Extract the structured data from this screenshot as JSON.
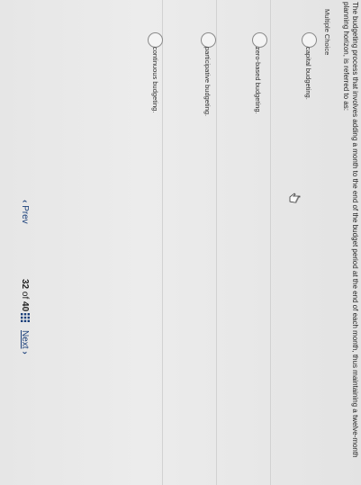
{
  "question": {
    "text": "The budgeting process that involves adding a month to the end of the budget period at the end of each month, thus maintaining a twelve-month planning horizon, is referred to as:",
    "type": "Multiple Choice"
  },
  "answers": [
    {
      "label": "capital budgeting."
    },
    {
      "label": "zero-based budgeting."
    },
    {
      "label": "participative budgeting."
    },
    {
      "label": "continuous budgeting."
    }
  ],
  "navigation": {
    "prev_label": "Prev",
    "current_page": "32",
    "of_label": "of",
    "total_pages": "40",
    "next_label": "Next"
  },
  "icons": {
    "prev": "chevron-left-icon",
    "next": "chevron-right-icon",
    "grid": "grid-icon",
    "cursor": "hand-cursor-icon"
  },
  "colors": {
    "link": "#1a3f7a",
    "background": "#e6e6e6"
  }
}
